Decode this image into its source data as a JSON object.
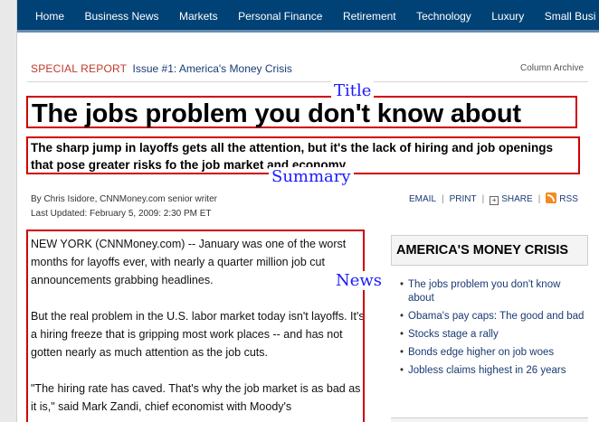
{
  "nav": {
    "items": [
      "Home",
      "Business News",
      "Markets",
      "Personal Finance",
      "Retirement",
      "Technology",
      "Luxury",
      "Small Busi"
    ]
  },
  "special_report": {
    "label": "SPECIAL REPORT",
    "issue": "Issue #1: America's Money Crisis",
    "column_archive": "Column Archive"
  },
  "article": {
    "title": "The jobs problem you don't know about",
    "summary": "The sharp jump in layoffs gets all the attention, but it's the lack of hiring and job openings that pose greater risks fo the job market and economy.",
    "byline": "By Chris Isidore, CNNMoney.com senior writer",
    "updated": "Last Updated: February 5, 2009: 2:30 PM ET",
    "paragraphs": [
      "NEW YORK (CNNMoney.com) -- January was one of the worst months for layoffs ever, with nearly a quarter million job cut announcements grabbing headlines.",
      "But the real problem in the U.S. labor market today isn't layoffs. It's a hiring freeze that is gripping most work places -- and has not gotten nearly as much attention as the job cuts.",
      "\"The hiring rate has caved. That's why the job market is as bad as it is,\" said Mark Zandi, chief economist with Moody's"
    ]
  },
  "tools": {
    "email": "EMAIL",
    "print": "PRINT",
    "share": "SHARE",
    "rss": "RSS",
    "sep": "|"
  },
  "annotations": {
    "title": "Title",
    "summary": "Summary",
    "news": "News"
  },
  "sidebar": {
    "heading": "AMERICA'S MONEY CRISIS",
    "items": [
      "The jobs problem you don't know about",
      "Obama's pay caps: The good and bad",
      "Stocks stage a rally",
      "Bonds edge higher on job woes",
      "Jobless claims highest in 26 years"
    ]
  },
  "colors": {
    "nav_bg": "#004276",
    "annotation_box": "#d00000",
    "annotation_text": "#1a1aff",
    "special_report": "#c0392b",
    "link": "#1a3a73"
  }
}
